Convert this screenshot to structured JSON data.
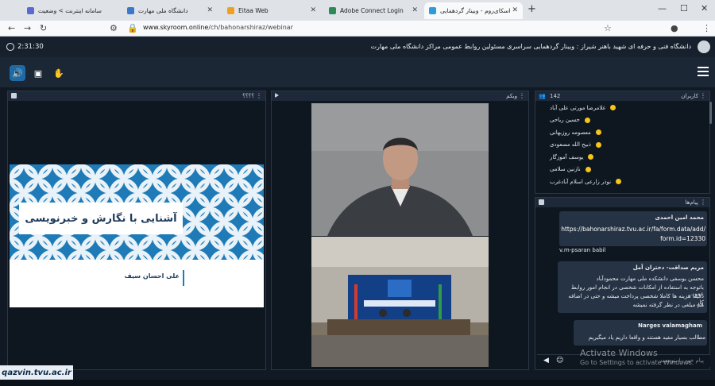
{
  "browser": {
    "tabs": [
      {
        "label": "سامانه اینترنت > وضعیت",
        "color": "#5b6ad0"
      },
      {
        "label": "دانشگاه ملی مهارت",
        "color": "#3c78c8"
      },
      {
        "label": "Eitaa Web",
        "color": "#f0a020"
      },
      {
        "label": "Adobe Connect Login",
        "color": "#2a8a5a"
      },
      {
        "label": "اسکای‌روم - وبینار گردهمایی",
        "color": "#2d9cdb"
      }
    ],
    "new_tab": "+",
    "url_host": "www.skyroom.online",
    "url_path": "/ch/bahonarshiraz/webinar"
  },
  "room": {
    "timer": "2:31:30",
    "title": "دانشگاه فنی و حرفه ای شهید باهنر شیراز : وبینار گردهمایی سراسری مسئولین روابط عمومی مراکز دانشگاه ملی مهارت"
  },
  "panels": {
    "doc_title": "؟؟؟؟",
    "webcam_title": "وبکم",
    "users_title": "کاربران",
    "users_count": "142",
    "chat_title": "پیام‌ها"
  },
  "slide": {
    "title": "آشنایی با نگارش و خبرنویسی",
    "author": "علی احسان سیف"
  },
  "users": [
    "غلامرضا مورتی علی آباد",
    "حسین ریاحی",
    "معصومه روزبهانی",
    "ذبیح الله مسعودی",
    "یوسف آموزگار",
    "نازنین سلامی",
    "نوذر زارعی اسلام آبادغرب"
  ],
  "chat": {
    "m1_name": "محمد امین احمدی",
    "m1_link1": "https://bahonarshiraz.tvu.ac.ir/fa/form.data/add/",
    "m1_link2": "form.id=12330",
    "m1_extra": "v.m-psaran babil",
    "m2_name": "مریم صداقت- دختران آمل",
    "m2_line1": "محسن یوسفی دانشکده ملی مهارت محمودآباد",
    "m2_line2": "باتوجه به استفاده از امکانات شخصی در انجام امور روابط عمو...",
    "m2_line3": "دقیقا هزینه ها کاملا شخصی پرداخت میشه و حتی در اضافه کار",
    "m2_line4": "هم مبلغی در نظر گرفته نمیشه",
    "m3_name": "Narges valamagham",
    "m3_text": "مطالب بسیار مفید هستند و واقعا داریم یاد میگیریم",
    "input_placeholder": "پیام خود را بنویسید"
  },
  "windows_watermark": {
    "line1": "Activate Windows",
    "line2": "Go to Settings to activate Windows."
  },
  "logo_text": "qazvin.tvu.ac.ir"
}
